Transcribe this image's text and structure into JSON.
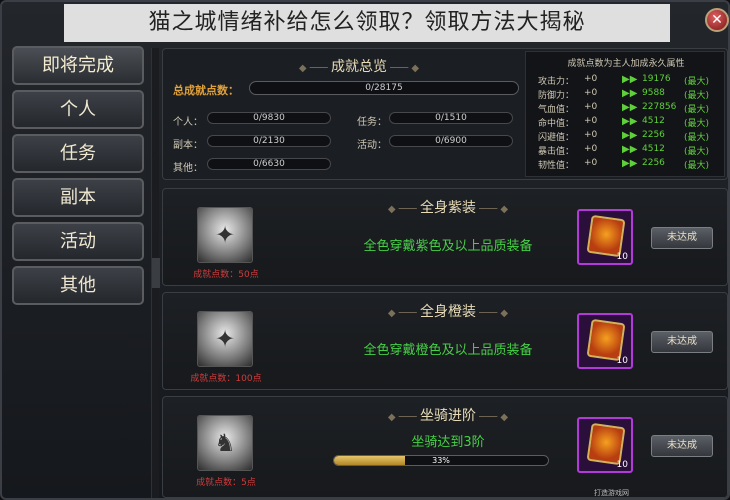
{
  "window": {
    "title": "猫之城情绪补给怎么领取？领取方法大揭秘",
    "close_symbol": "✕"
  },
  "sidebar": {
    "items": [
      {
        "label": "即将完成"
      },
      {
        "label": "个人"
      },
      {
        "label": "任务"
      },
      {
        "label": "副本"
      },
      {
        "label": "活动"
      },
      {
        "label": "其他"
      }
    ]
  },
  "summary": {
    "title": "成就总览",
    "total_label": "总成就点数：",
    "total_value": "0/28175",
    "stats": [
      {
        "label": "个人：",
        "value": "0/9830"
      },
      {
        "label": "任务：",
        "value": "0/1510"
      },
      {
        "label": "副本：",
        "value": "0/2130"
      },
      {
        "label": "活动：",
        "value": "0/6900"
      },
      {
        "label": "其他：",
        "value": "0/6630"
      }
    ],
    "attributes": {
      "title": "成就点数为主人加成永久属性",
      "rows": [
        {
          "name": "攻击力：",
          "plus": "+0",
          "value": "19176",
          "max": "(最大)"
        },
        {
          "name": "防御力：",
          "plus": "+0",
          "value": "9588",
          "max": "(最大)"
        },
        {
          "name": "气血值：",
          "plus": "+0",
          "value": "227856",
          "max": "(最大)"
        },
        {
          "name": "命中值：",
          "plus": "+0",
          "value": "4512",
          "max": "(最大)"
        },
        {
          "name": "闪避值：",
          "plus": "+0",
          "value": "2256",
          "max": "(最大)"
        },
        {
          "name": "暴击值：",
          "plus": "+0",
          "value": "4512",
          "max": "(最大)"
        },
        {
          "name": "韧性值：",
          "plus": "+0",
          "value": "2256",
          "max": "(最大)"
        }
      ]
    }
  },
  "achievements": [
    {
      "title": "全身紫装",
      "description": "全色穿戴紫色及以上品质装备",
      "points": "成就点数：50点",
      "reward_count": "10",
      "status": "未达成",
      "icon_glyph": "✦"
    },
    {
      "title": "全身橙装",
      "description": "全色穿戴橙色及以上品质装备",
      "points": "成就点数：100点",
      "reward_count": "10",
      "status": "未达成",
      "icon_glyph": "✦"
    },
    {
      "title": "坐骑进阶",
      "description": "坐骑达到3阶",
      "points": "成就点数：5点",
      "reward_count": "10",
      "status": "未达成",
      "icon_glyph": "♞",
      "progress_text": "33%",
      "progress": 0.33
    }
  ],
  "watermark": "打造游戏网"
}
